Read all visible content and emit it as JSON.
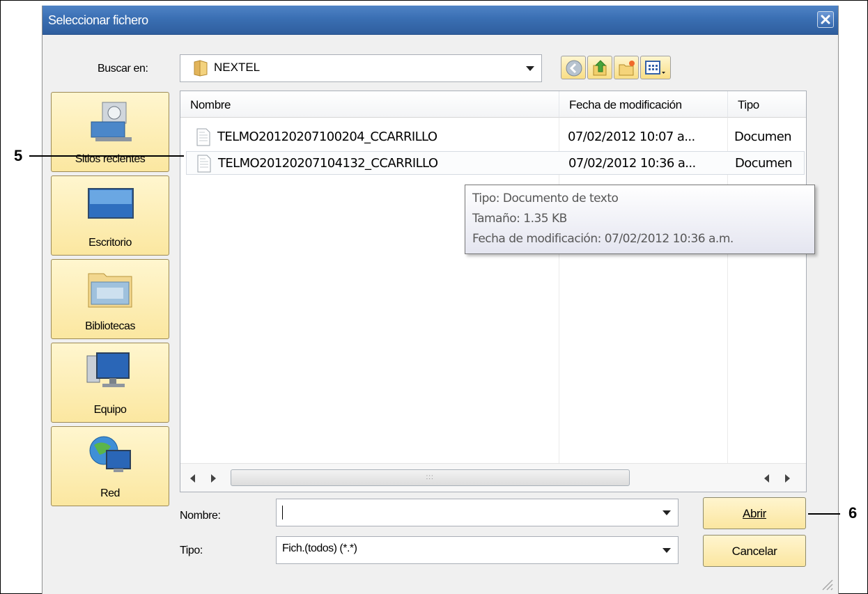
{
  "dialog": {
    "title": "Seleccionar fichero",
    "look_in_label": "Buscar en:",
    "look_in_value": "NEXTEL",
    "toolbar_icons": [
      "back-icon",
      "up-folder-icon",
      "new-folder-icon",
      "view-menu-icon"
    ],
    "places": [
      {
        "label": "Sitios recientes",
        "icon": "recent-places-icon"
      },
      {
        "label": "Escritorio",
        "icon": "desktop-icon"
      },
      {
        "label": "Bibliotecas",
        "icon": "libraries-icon"
      },
      {
        "label": "Equipo",
        "icon": "computer-icon"
      },
      {
        "label": "Red",
        "icon": "network-icon"
      }
    ],
    "columns": [
      "Nombre",
      "Fecha de modificación",
      "Tipo"
    ],
    "files": [
      {
        "name": "TELMO20120207100204_CCARRILLO",
        "date": "07/02/2012 10:07 a...",
        "type": "Documen"
      },
      {
        "name": "TELMO20120207104132_CCARRILLO",
        "date": "07/02/2012 10:36 a...",
        "type": "Documen"
      }
    ],
    "tooltip": {
      "line1": "Tipo: Documento de texto",
      "line2": "Tamaño: 1.35 KB",
      "line3": "Fecha de modificación: 07/02/2012 10:36 a.m."
    },
    "name_label": "Nombre:",
    "name_value": "",
    "type_label": "Tipo:",
    "type_value": "Fich.(todos) (*.*)",
    "open_button": "Abrir",
    "cancel_button": "Cancelar"
  },
  "annotations": {
    "callout_5": "5",
    "callout_6": "6"
  },
  "colors": {
    "titlebar": "#3a6fb3",
    "button_fill": "#fbe6a0",
    "dialog_bg": "#f0f0f0"
  }
}
